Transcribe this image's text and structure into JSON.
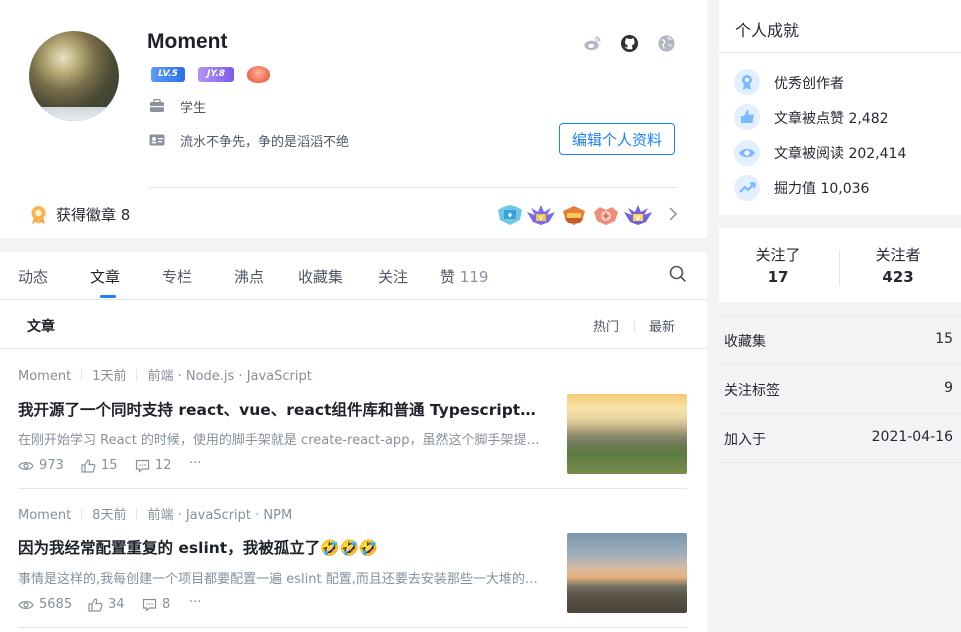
{
  "profile": {
    "username": "Moment",
    "level_badge": "LV.5",
    "jy_badge": "JY.8",
    "job": "学生",
    "bio": "流水不争先，争的是滔滔不绝",
    "edit_button": "编辑个人资料",
    "medals_label": "获得徽章",
    "medals_count": "8"
  },
  "tabs": [
    {
      "label": "动态"
    },
    {
      "label": "文章"
    },
    {
      "label": "专栏"
    },
    {
      "label": "沸点"
    },
    {
      "label": "收藏集"
    },
    {
      "label": "关注"
    },
    {
      "label": "赞",
      "count": "119"
    }
  ],
  "list": {
    "section_title": "文章",
    "sort_hot": "热门",
    "sort_new": "最新"
  },
  "articles": [
    {
      "author": "Moment",
      "time": "1天前",
      "tags": "前端 · Node.js · JavaScript",
      "title": "我开源了一个同时支持 react、vue、react组件库和普通 Typescript库的脚手架",
      "desc": "在刚开始学习 React 的时候，使用的脚手架就是 create-react-app，虽然这个脚手架提供了很多便利",
      "views": "973",
      "likes": "15",
      "comments": "12",
      "more": "···"
    },
    {
      "author": "Moment",
      "time": "8天前",
      "tags": "前端 · JavaScript · NPM",
      "title": "因为我经常配置重复的 eslint，我被孤立了🤣🤣🤣",
      "desc": "事情是这样的,我每创建一个项目都要配置一遍 eslint 配置,而且还要去安装那些一大堆的依赖",
      "views": "5685",
      "likes": "34",
      "comments": "8",
      "more": "···"
    }
  ],
  "achievements": {
    "title": "个人成就",
    "items": [
      {
        "label": "优秀创作者",
        "value": ""
      },
      {
        "label": "文章被点赞",
        "value": "2,482"
      },
      {
        "label": "文章被阅读",
        "value": "202,414"
      },
      {
        "label": "掘力值",
        "value": "10,036"
      }
    ]
  },
  "follow": {
    "following_label": "关注了",
    "following_count": "17",
    "followers_label": "关注者",
    "followers_count": "423"
  },
  "side_rows": [
    {
      "label": "收藏集",
      "value": "15"
    },
    {
      "label": "关注标签",
      "value": "9"
    },
    {
      "label": "加入于",
      "value": "2021-04-16"
    }
  ],
  "colors": {
    "accent": "#1e80ff",
    "text": "#252933",
    "muted": "#86909c"
  }
}
